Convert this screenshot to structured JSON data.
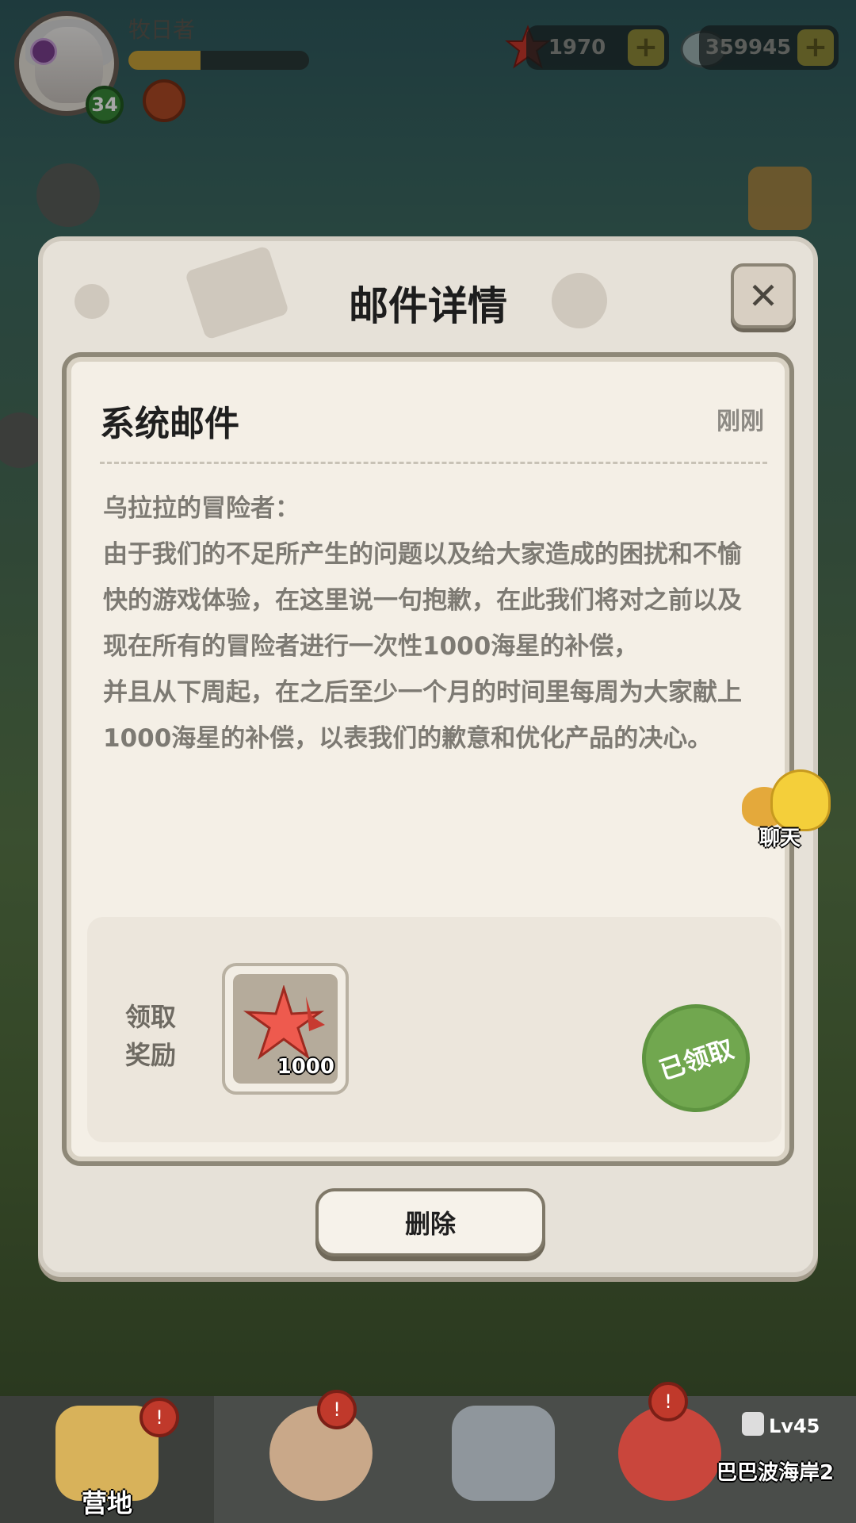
{
  "hud": {
    "player_name": "牧日者",
    "level": "34",
    "xp_progress": 0.4,
    "starfish_amount": "1970",
    "shell_amount": "359945",
    "plus_symbol": "+"
  },
  "dialog": {
    "title": "邮件详情",
    "close_symbol": "✕",
    "mail": {
      "sender": "系统邮件",
      "time": "刚刚",
      "body": [
        "乌拉拉的冒险者：",
        "由于我们的不足所产生的问题以及给大家造成的困扰和不愉快的游戏体验，在这里说一句抱歉，在此我们将对之前以及现在所有的冒险者进行一次性1000海星的补偿，",
        "并且从下周起，在之后至少一个月的时间里每周为大家献上1000海星的补偿，以表我们的歉意和优化产品的决心。"
      ]
    },
    "reward": {
      "label": "领取奖励",
      "item_icon": "starfish-icon",
      "item_count": "1000",
      "claimed_stamp": "已领取"
    },
    "delete_button": "删除"
  },
  "chat": {
    "label": "聊天"
  },
  "bottom_nav": {
    "tabs": [
      {
        "label": "营地",
        "icon": "camp-icon"
      },
      {
        "label": "",
        "icon": "hero-icon"
      },
      {
        "label": "",
        "icon": "equipment-icon"
      },
      {
        "label": "",
        "icon": "pet-icon"
      }
    ],
    "locked_area": {
      "level": "Lv45",
      "name": "巴巴波海岸2"
    }
  },
  "colors": {
    "dialog_bg": "#e6e1d8",
    "card_bg": "#f4efe6",
    "stamp_green": "#71a74f",
    "text_dark": "#1d1d1d",
    "text_body": "#7d7a73"
  }
}
